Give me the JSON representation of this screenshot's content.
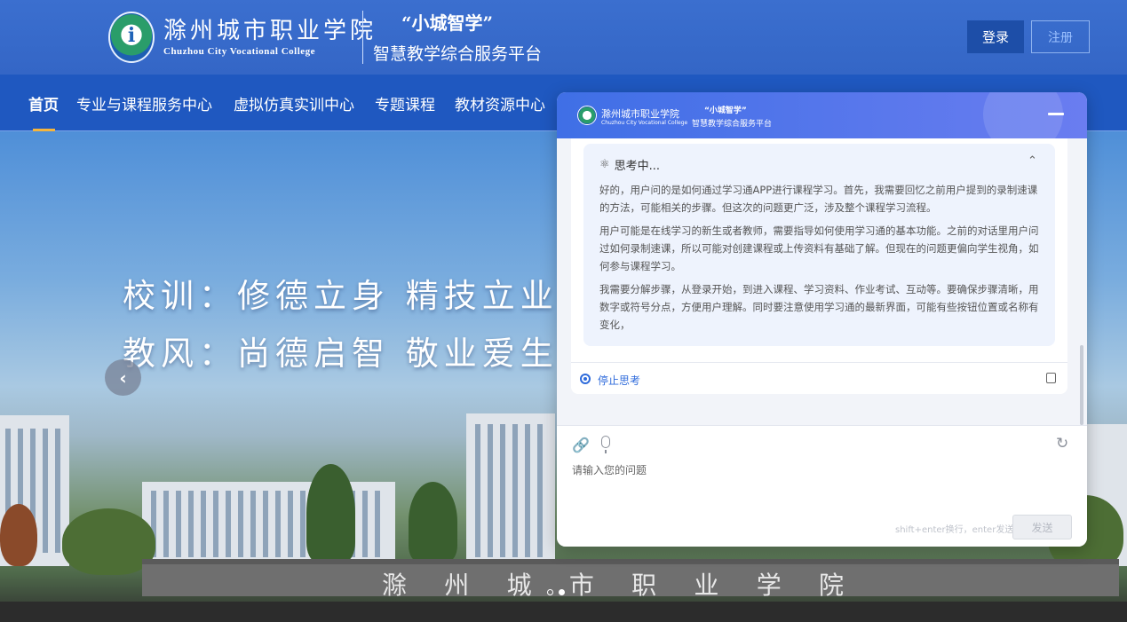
{
  "header": {
    "college_cn": "滁州城市职业学院",
    "college_en": "Chuzhou City Vocational College",
    "slogan": "“小城智学”",
    "platform": "智慧教学综合服务平台",
    "login_label": "登录",
    "register_label": "注册",
    "logo_letter": "i"
  },
  "nav": {
    "items": [
      {
        "label": "首页"
      },
      {
        "label": "专业与课程服务中心"
      },
      {
        "label": "虚拟仿真实训中心"
      },
      {
        "label": "专题课程"
      },
      {
        "label": "教材资源中心"
      }
    ],
    "active_color": "#f5b53d"
  },
  "banner": {
    "motto_1": "校训：修德立身 精技立业",
    "motto_2": "教风：尚德启智 敬业爱生",
    "wall_chars": [
      "滁",
      "州",
      "城",
      "市",
      "职",
      "业",
      "学",
      "院"
    ],
    "prev_arrow": "‹"
  },
  "chat": {
    "title_cn": "滁州城市职业学院",
    "title_en": "Chuzhou City Vocational College",
    "sub_slogan": "“小城智学”",
    "sub_platform": "智慧教学综合服务平台",
    "thinking_label": "思考中...",
    "thinking_icon": "⚛",
    "collapse_icon": "⌃",
    "paragraphs": [
      "好的，用户问的是如何通过学习通APP进行课程学习。首先，我需要回忆之前用户提到的录制速课的方法，可能相关的步骤。但这次的问题更广泛，涉及整个课程学习流程。",
      "用户可能是在线学习的新生或者教师，需要指导如何使用学习通的基本功能。之前的对话里用户问过如何录制速课，所以可能对创建课程或上传资料有基础了解。但现在的问题更偏向学生视角，如何参与课程学习。",
      "我需要分解步骤，从登录开始，到进入课程、学习资料、作业考试、互动等。要确保步骤清晰，用数字或符号分点，方便用户理解。同时要注意使用学习通的最新界面，可能有些按钮位置或名称有变化，"
    ],
    "stop_label": "停止思考",
    "input_placeholder": "请输入您的问题",
    "hint": "shift+enter换行，enter发送",
    "send_label": "发送",
    "accent": "#2f6bdb"
  }
}
